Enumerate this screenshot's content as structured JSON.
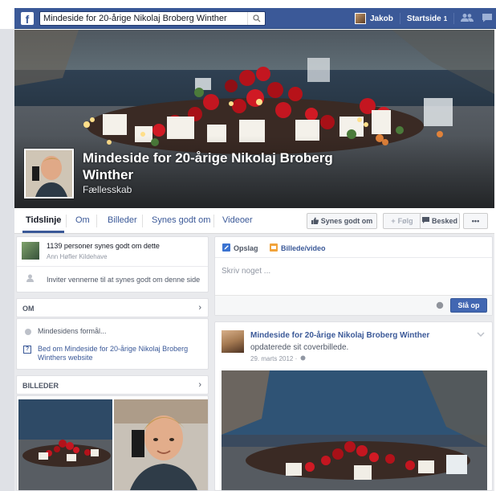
{
  "topbar": {
    "logo": "f",
    "search_value": "Mindeside for 20-årige Nikolaj Broberg Winther",
    "user_name": "Jakob",
    "home_label": "Startside",
    "home_count": "1"
  },
  "page": {
    "name": "Mindeside for 20-årige Nikolaj Broberg Winther",
    "category": "Fællesskab"
  },
  "tabs": [
    "Tidslinje",
    "Om",
    "Billeder",
    "Synes godt om",
    "Videoer"
  ],
  "actions": {
    "like": "Synes godt om",
    "follow": "Følg",
    "message": "Besked",
    "more": "•••"
  },
  "likes_box": {
    "count_text": "1139 personer synes godt om dette",
    "friend_text": "Ann Høfler Kildehave",
    "invite_text": "Inviter vennerne til at synes godt om denne side"
  },
  "about_box": {
    "title": "OM",
    "purpose": "Mindesidens formål...",
    "website_link": "Bed om Mindeside for 20-årige Nikolaj Broberg Winthers website"
  },
  "photos_box": {
    "title": "BILLEDER"
  },
  "composer": {
    "tab_post": "Opslag",
    "tab_media": "Billede/video",
    "placeholder": "Skriv noget ...",
    "publish": "Slå op"
  },
  "post": {
    "author": "Mindeside for 20-årige Nikolaj Broberg Winther",
    "action": "opdaterede sit coverbillede.",
    "date": "29. marts 2012 ·"
  },
  "colors": {
    "brand": "#3b5998",
    "topbar_border": "#29487d",
    "page_bg": "#e9eaed"
  },
  "icons": [
    "facebook-logo-icon",
    "search-icon",
    "friends-icon",
    "messages-icon",
    "globe-icon",
    "like-thumb-icon",
    "message-icon",
    "edit-icon",
    "photo-icon",
    "info-icon",
    "chevron-right-icon",
    "chevron-down-icon"
  ]
}
